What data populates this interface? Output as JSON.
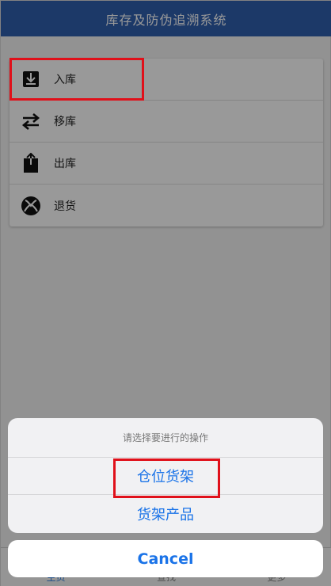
{
  "header": {
    "title": "库存及防伪追溯系统"
  },
  "menu": {
    "items": [
      {
        "label": "入库",
        "icon": "inbox-download-icon"
      },
      {
        "label": "移库",
        "icon": "swap-arrows-icon"
      },
      {
        "label": "出库",
        "icon": "outbox-upload-icon"
      },
      {
        "label": "退货",
        "icon": "xbox-icon"
      }
    ]
  },
  "tabbar": {
    "tabs": [
      {
        "label": "主页"
      },
      {
        "label": "查找"
      },
      {
        "label": "更多"
      }
    ]
  },
  "action_sheet": {
    "title": "请选择要进行的操作",
    "options": [
      "仓位货架",
      "货架产品"
    ],
    "cancel_label": "Cancel"
  },
  "colors": {
    "header_bg": "#2f5fae",
    "accent": "#1a73e8",
    "highlight_border": "#e0101a"
  }
}
